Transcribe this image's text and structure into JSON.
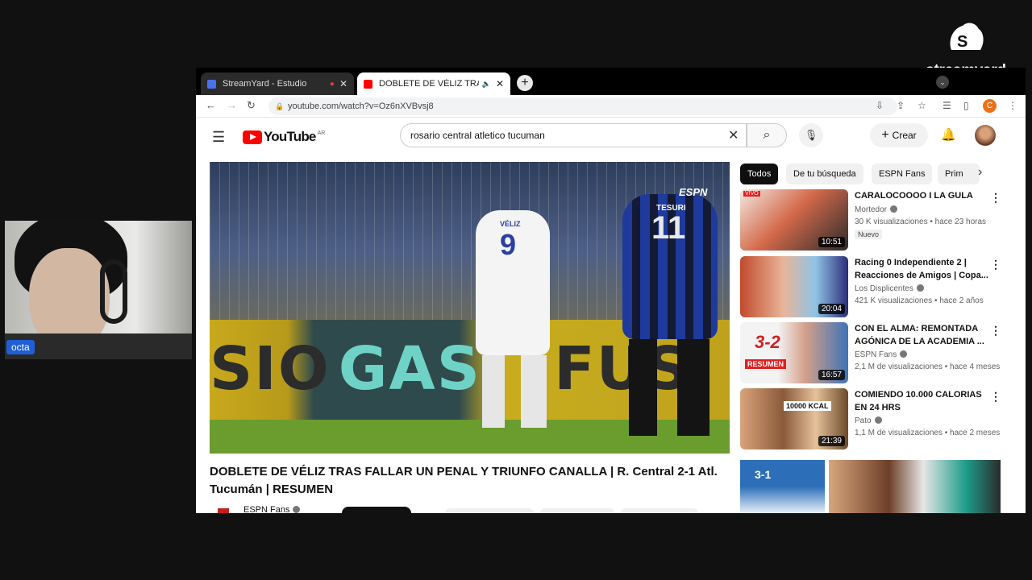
{
  "overlay": {
    "brand": "streamyard",
    "cam_name": "octa"
  },
  "browser": {
    "tabs": [
      {
        "title": "StreamYard - Estudio",
        "favicon_color": "#4a72e8"
      },
      {
        "title": "DOBLETE DE VÉLIZ TRAS FA",
        "favicon_color": "#ff0000"
      }
    ],
    "url": "youtube.com/watch?v=Oz6nXVBvsj8",
    "profile_initial": "C"
  },
  "youtube": {
    "logo_text": "YouTube",
    "country_code": "AR",
    "search_query": "rosario central atletico tucuman",
    "create_label": "Crear",
    "chips": [
      "Todos",
      "De tu búsqueda",
      "ESPN Fans",
      "Prim"
    ],
    "player": {
      "board_text_1": "SIO",
      "board_text_2": "GAS",
      "board_text_3": "FUS",
      "player1_name": "VÉLIZ",
      "player1_number": "9",
      "player2_name": "TESURI",
      "player2_number": "11",
      "broadcaster": "ESPN"
    },
    "video_title": "DOBLETE DE VÉLIZ TRAS FALLAR UN PENAL Y TRIUNFO CANALLA | R. Central 2-1 Atl. Tucumán | RESUMEN",
    "channel_name": "ESPN Fans",
    "recommendations": [
      {
        "title": "CARALOCOOOO I LA GULA",
        "channel": "Mortedor",
        "meta": "30 K visualizaciones • hace 23 horas",
        "duration": "10:51",
        "badge": "Nuevo"
      },
      {
        "title": "Racing 0 Independiente 2 | Reacciones de Amigos | Copa...",
        "channel": "Los Displicentes",
        "meta": "421 K visualizaciones • hace 2 años",
        "duration": "20:04"
      },
      {
        "title": "CON EL ALMA: REMONTADA AGÓNICA DE LA ACADEMIA ...",
        "channel": "ESPN Fans",
        "meta": "2,1 M de visualizaciones • hace 4 meses",
        "duration": "16:57",
        "thumb_score": "3-2",
        "thumb_tag": "RESUMEN"
      },
      {
        "title": "COMIENDO 10.000 CALORIAS EN 24 HRS",
        "channel": "Pato",
        "meta": "1,1 M de visualizaciones • hace 2 meses",
        "duration": "21:39",
        "thumb_text": "10000 KCAL"
      }
    ],
    "bottom_thumb_score": "3-1"
  }
}
